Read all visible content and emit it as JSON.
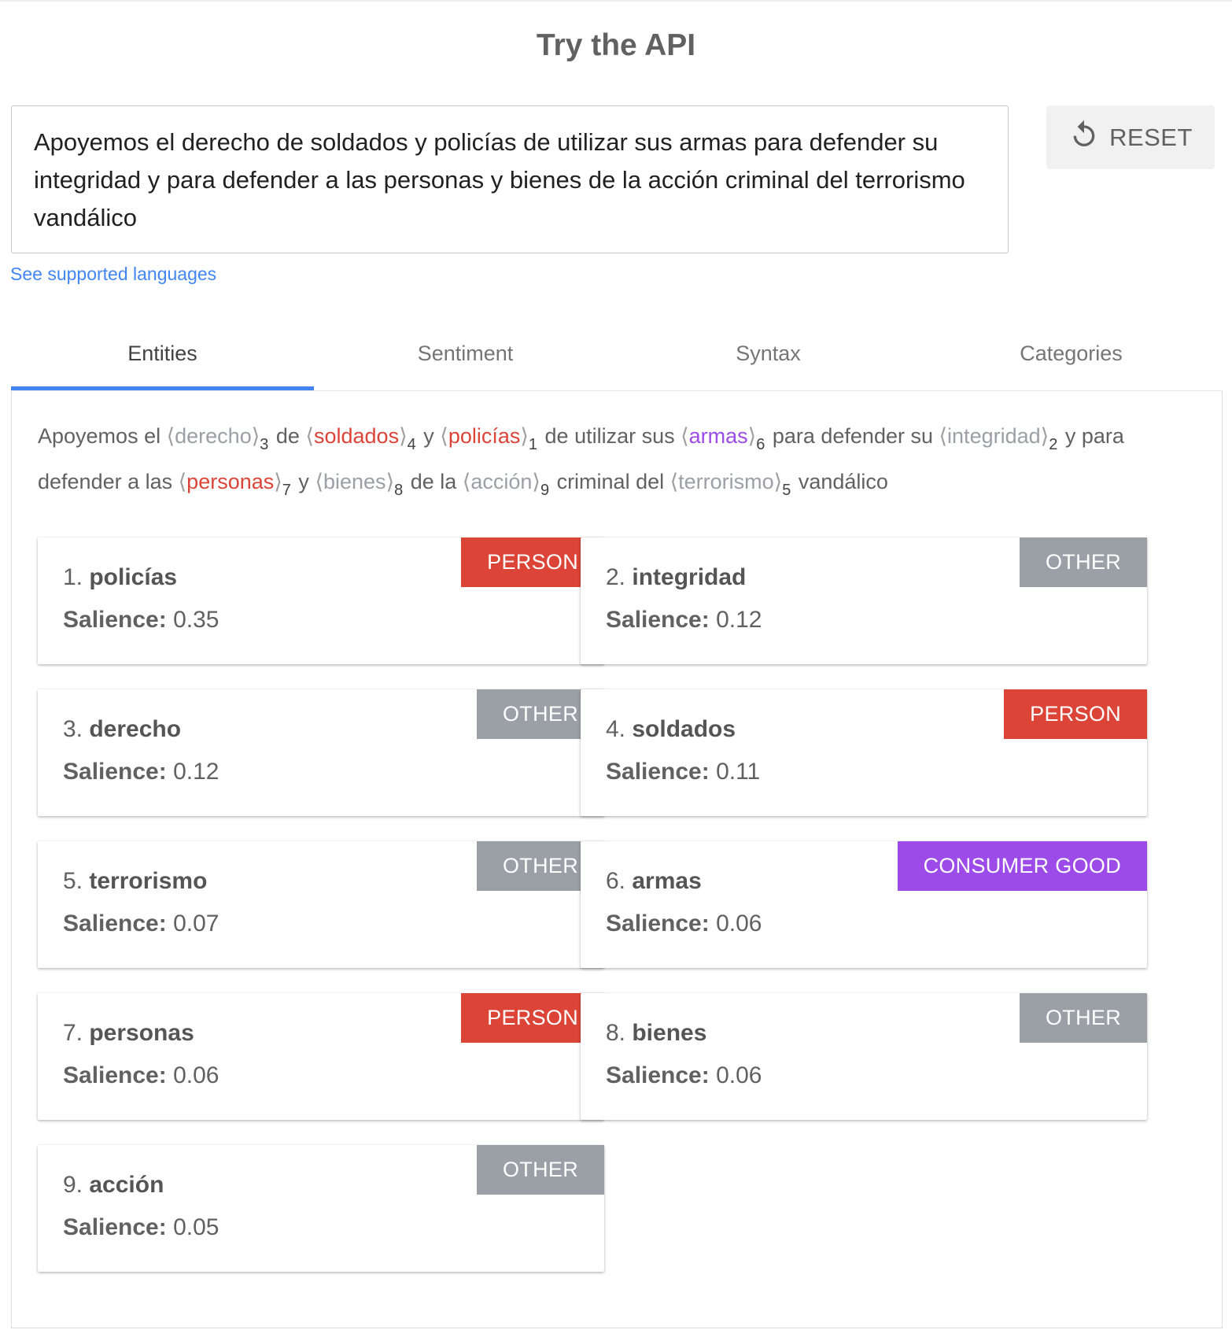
{
  "title": "Try the API",
  "input_text": "Apoyemos el derecho de soldados y policías de utilizar sus armas para defender su integridad y para defender a las personas y bienes de la acción criminal del terrorismo vandálico",
  "reset_label": "RESET",
  "languages_link": "See supported languages",
  "tabs": [
    {
      "label": "Entities",
      "active": true
    },
    {
      "label": "Sentiment",
      "active": false
    },
    {
      "label": "Syntax",
      "active": false
    },
    {
      "label": "Categories",
      "active": false
    }
  ],
  "colors": {
    "PERSON": "#db4437",
    "OTHER": "#9aa0a6",
    "CONSUMER GOOD": "#9c4ae8",
    "tab_indicator": "#4285f4",
    "link": "#4285f4"
  },
  "annotated": [
    {
      "t": "Apoyemos el "
    },
    {
      "e": "derecho",
      "n": "3",
      "type": "OTHER"
    },
    {
      "t": " de "
    },
    {
      "e": "soldados",
      "n": "4",
      "type": "PERSON"
    },
    {
      "t": " y "
    },
    {
      "e": "policías",
      "n": "1",
      "type": "PERSON"
    },
    {
      "t": " de utilizar sus "
    },
    {
      "e": "armas",
      "n": "6",
      "type": "CONSUMER GOOD"
    },
    {
      "t": " para defender su "
    },
    {
      "e": "integridad",
      "n": "2",
      "type": "OTHER"
    },
    {
      "t": " y para defender a las "
    },
    {
      "e": "personas",
      "n": "7",
      "type": "PERSON"
    },
    {
      "t": " y "
    },
    {
      "e": "bienes",
      "n": "8",
      "type": "OTHER"
    },
    {
      "t": " de la "
    },
    {
      "e": "acción",
      "n": "9",
      "type": "OTHER"
    },
    {
      "t": " criminal del "
    },
    {
      "e": "terrorismo",
      "n": "5",
      "type": "OTHER"
    },
    {
      "t": " vandálico"
    }
  ],
  "salience_label": "Salience:",
  "entities": [
    {
      "index": "1.",
      "name": "policías",
      "type": "PERSON",
      "salience": "0.35"
    },
    {
      "index": "2.",
      "name": "integridad",
      "type": "OTHER",
      "salience": "0.12"
    },
    {
      "index": "3.",
      "name": "derecho",
      "type": "OTHER",
      "salience": "0.12"
    },
    {
      "index": "4.",
      "name": "soldados",
      "type": "PERSON",
      "salience": "0.11"
    },
    {
      "index": "5.",
      "name": "terrorismo",
      "type": "OTHER",
      "salience": "0.07"
    },
    {
      "index": "6.",
      "name": "armas",
      "type": "CONSUMER GOOD",
      "salience": "0.06"
    },
    {
      "index": "7.",
      "name": "personas",
      "type": "PERSON",
      "salience": "0.06"
    },
    {
      "index": "8.",
      "name": "bienes",
      "type": "OTHER",
      "salience": "0.06"
    },
    {
      "index": "9.",
      "name": "acción",
      "type": "OTHER",
      "salience": "0.05"
    }
  ]
}
